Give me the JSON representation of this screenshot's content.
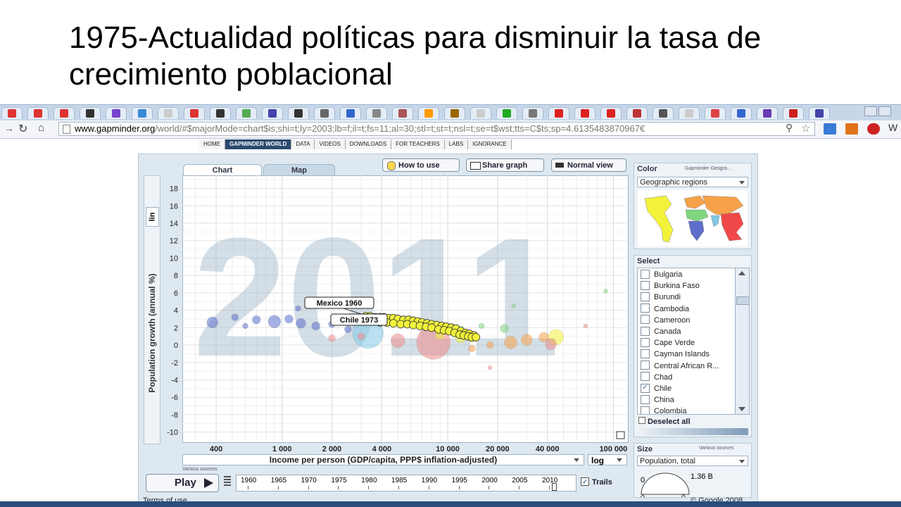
{
  "slide": {
    "title": "1975-Actualidad políticas para disminuir la tasa de crecimiento poblacional"
  },
  "browser": {
    "url_host": "www.gapminder.org",
    "url_path": "/world/#$majorMode=chart$is;shi=t;ly=2003;lb=f;il=t;fs=11;al=30;stl=t;st=t;nsl=t;se=t$wst;tts=C$ts;sp=4.6135483870967€"
  },
  "site_nav": [
    "HOME",
    "GAPMINDER WORLD",
    "DATA",
    "VIDEOS",
    "DOWNLOADS",
    "FOR TEACHERS",
    "LABS",
    "IGNORANCE"
  ],
  "tabs": {
    "chart": "Chart",
    "map": "Map"
  },
  "toolbar": {
    "how_to_use": "How to use",
    "share_graph": "Share graph",
    "normal_view": "Normal view"
  },
  "y_axis": {
    "scale_label": "lin"
  },
  "x_axis": {
    "scale_value": "log",
    "source_note": "Various sources"
  },
  "color_panel": {
    "title": "Color",
    "source": "Gapminder Geogra...",
    "selected": "Geographic regions"
  },
  "select_panel": {
    "title": "Select",
    "countries": [
      "Bulgaria",
      "Burkina Faso",
      "Burundi",
      "Cambodia",
      "Cameroon",
      "Canada",
      "Cape Verde",
      "Cayman Islands",
      "Central African R...",
      "Chad",
      "Chile",
      "China",
      "Colombia"
    ],
    "checked": [
      "Chile"
    ],
    "deselect_all": "Deselect all"
  },
  "size_panel": {
    "title": "Size",
    "source": "Various sources",
    "selected": "Population, total",
    "min_label": "0",
    "max_label": "1.36 B"
  },
  "play": {
    "label": "Play",
    "years": [
      "1960",
      "1965",
      "1970",
      "1975",
      "1980",
      "1985",
      "1990",
      "1995",
      "2000",
      "2005",
      "2010"
    ],
    "trails_label": "Trails"
  },
  "footer": {
    "terms": "Terms of use",
    "copyright": "© Google 2008"
  },
  "chart_data": {
    "type": "scatter",
    "watermark_year": "2011",
    "xlabel": "Income per person (GDP/capita, PPP$ inflation-adjusted)",
    "ylabel": "Population growth (annual %)",
    "x_scale": "log",
    "xlim": [
      250,
      120000
    ],
    "ylim": [
      -11,
      19.5
    ],
    "x_ticks": [
      400,
      1000,
      2000,
      4000,
      10000,
      20000,
      40000,
      100000
    ],
    "x_tick_labels": [
      "400",
      "1 000",
      "2 000",
      "4 000",
      "10 000",
      "20 000",
      "40 000",
      "100 000"
    ],
    "y_ticks": [
      18,
      16,
      14,
      12,
      10,
      8,
      6,
      4,
      2,
      0,
      -2,
      -4,
      -6,
      -8,
      -10
    ],
    "y_tick_labels": [
      "18",
      "16",
      "14",
      "12",
      "10",
      "8",
      "6",
      "4",
      "2",
      "0",
      "-2",
      "-4",
      "-6",
      "-8",
      "-10"
    ],
    "annotations": [
      {
        "text": "Mexico 1960",
        "x": 3200,
        "y": 3.4
      },
      {
        "text": "Chile 1973",
        "x": 3150,
        "y": 2.7
      }
    ],
    "trail_series": [
      {
        "name": "Mexico",
        "color": "#f2f23a",
        "points": [
          [
            3200,
            3.3
          ],
          [
            3400,
            3.3
          ],
          [
            3650,
            3.2
          ],
          [
            3900,
            3.2
          ],
          [
            4100,
            3.2
          ],
          [
            4400,
            3.1
          ],
          [
            4700,
            3.1
          ],
          [
            5000,
            3.0
          ],
          [
            5400,
            2.9
          ],
          [
            5800,
            2.9
          ],
          [
            6200,
            2.8
          ],
          [
            6600,
            2.7
          ],
          [
            7000,
            2.6
          ],
          [
            7500,
            2.5
          ],
          [
            8000,
            2.4
          ],
          [
            8600,
            2.3
          ],
          [
            9200,
            2.2
          ],
          [
            9800,
            2.1
          ],
          [
            10500,
            2.0
          ],
          [
            11200,
            1.9
          ],
          [
            12000,
            1.6
          ],
          [
            12800,
            1.4
          ],
          [
            13500,
            1.3
          ],
          [
            14400,
            1.1
          ]
        ]
      },
      {
        "name": "Chile",
        "color": "#f2f23a",
        "points": [
          [
            3150,
            2.8
          ],
          [
            3500,
            2.7
          ],
          [
            3900,
            2.6
          ],
          [
            4300,
            2.6
          ],
          [
            4700,
            2.5
          ],
          [
            5200,
            2.4
          ],
          [
            5700,
            2.4
          ],
          [
            6200,
            2.3
          ],
          [
            6800,
            2.2
          ],
          [
            7400,
            2.1
          ],
          [
            8000,
            2.0
          ],
          [
            8800,
            1.8
          ],
          [
            9500,
            1.7
          ],
          [
            10200,
            1.6
          ],
          [
            11000,
            1.4
          ],
          [
            11800,
            1.2
          ],
          [
            12500,
            1.1
          ],
          [
            13300,
            1.0
          ],
          [
            14000,
            0.9
          ],
          [
            14800,
            0.9
          ]
        ]
      }
    ],
    "points_2011": [
      {
        "region": "South Asia",
        "x": 3300,
        "y": 1.4,
        "r": 22,
        "color": "#82c7e6"
      },
      {
        "region": "East Asia & Pacific",
        "x": 8200,
        "y": 0.3,
        "r": 24,
        "color": "#f08c8c"
      },
      {
        "region": "East Asia & Pacific",
        "x": 5000,
        "y": 0.5,
        "r": 10,
        "color": "#f08c8c"
      },
      {
        "region": "Sub-Saharan Africa",
        "x": 380,
        "y": 2.6,
        "r": 8,
        "color": "#5d6ecb"
      },
      {
        "region": "Sub-Saharan Africa",
        "x": 520,
        "y": 3.2,
        "r": 5,
        "color": "#5d6ecb"
      },
      {
        "region": "Sub-Saharan Africa",
        "x": 700,
        "y": 2.9,
        "r": 6,
        "color": "#5d6ecb"
      },
      {
        "region": "Sub-Saharan Africa",
        "x": 900,
        "y": 2.7,
        "r": 9,
        "color": "#5d6ecb"
      },
      {
        "region": "Sub-Saharan Africa",
        "x": 1100,
        "y": 3.0,
        "r": 6,
        "color": "#5d6ecb"
      },
      {
        "region": "Sub-Saharan Africa",
        "x": 1300,
        "y": 2.5,
        "r": 7,
        "color": "#5d6ecb"
      },
      {
        "region": "Sub-Saharan Africa",
        "x": 1600,
        "y": 2.2,
        "r": 6,
        "color": "#5d6ecb"
      },
      {
        "region": "Sub-Saharan Africa",
        "x": 2000,
        "y": 2.4,
        "r": 5,
        "color": "#5d6ecb"
      },
      {
        "region": "Sub-Saharan Africa",
        "x": 600,
        "y": 2.2,
        "r": 4,
        "color": "#5d6ecb"
      },
      {
        "region": "Sub-Saharan Africa",
        "x": 1250,
        "y": 4.2,
        "r": 4,
        "color": "#5d6ecb"
      },
      {
        "region": "Sub-Saharan Africa",
        "x": 2500,
        "y": 1.8,
        "r": 5,
        "color": "#5d6ecb"
      },
      {
        "region": "Middle East & North Africa",
        "x": 16000,
        "y": 2.2,
        "r": 4,
        "color": "#7ed67e"
      },
      {
        "region": "Middle East & North Africa",
        "x": 25000,
        "y": 4.5,
        "r": 3,
        "color": "#7ed67e"
      },
      {
        "region": "Middle East & North Africa",
        "x": 90000,
        "y": 6.2,
        "r": 3,
        "color": "#7ed67e"
      },
      {
        "region": "Middle East & North Africa",
        "x": 12000,
        "y": 1.8,
        "r": 5,
        "color": "#7ed67e"
      },
      {
        "region": "Middle East & North Africa",
        "x": 22000,
        "y": 1.9,
        "r": 6,
        "color": "#7ed67e"
      },
      {
        "region": "Europe & Central Asia",
        "x": 24000,
        "y": 0.3,
        "r": 9,
        "color": "#f7a248"
      },
      {
        "region": "Europe & Central Asia",
        "x": 30000,
        "y": 0.6,
        "r": 8,
        "color": "#f7a248"
      },
      {
        "region": "Europe & Central Asia",
        "x": 38000,
        "y": 0.9,
        "r": 7,
        "color": "#f7a248"
      },
      {
        "region": "Europe & Central Asia",
        "x": 18000,
        "y": 0.0,
        "r": 5,
        "color": "#f7a248"
      },
      {
        "region": "Europe & Central Asia",
        "x": 14000,
        "y": -0.4,
        "r": 5,
        "color": "#f7a248"
      },
      {
        "region": "America",
        "x": 45000,
        "y": 0.9,
        "r": 11,
        "color": "#f2f23a"
      },
      {
        "region": "America",
        "x": 12000,
        "y": 0.9,
        "r": 8,
        "color": "#f2f23a"
      },
      {
        "region": "America",
        "x": 9000,
        "y": 1.2,
        "r": 7,
        "color": "#f2f23a"
      },
      {
        "region": "America",
        "x": 14000,
        "y": 0.8,
        "r": 6,
        "color": "#f2f23a"
      },
      {
        "region": "East Asia & Pacific",
        "x": 42000,
        "y": 0.1,
        "r": 8,
        "color": "#f08c8c"
      },
      {
        "region": "East Asia & Pacific",
        "x": 18000,
        "y": -2.6,
        "r": 3,
        "color": "#f08c8c"
      },
      {
        "region": "East Asia & Pacific",
        "x": 68000,
        "y": 2.2,
        "r": 3,
        "color": "#f08c8c"
      },
      {
        "region": "East Asia & Pacific",
        "x": 3000,
        "y": 1.0,
        "r": 5,
        "color": "#f08c8c"
      },
      {
        "region": "East Asia & Pacific",
        "x": 2000,
        "y": 0.8,
        "r": 5,
        "color": "#f08c8c"
      }
    ]
  }
}
